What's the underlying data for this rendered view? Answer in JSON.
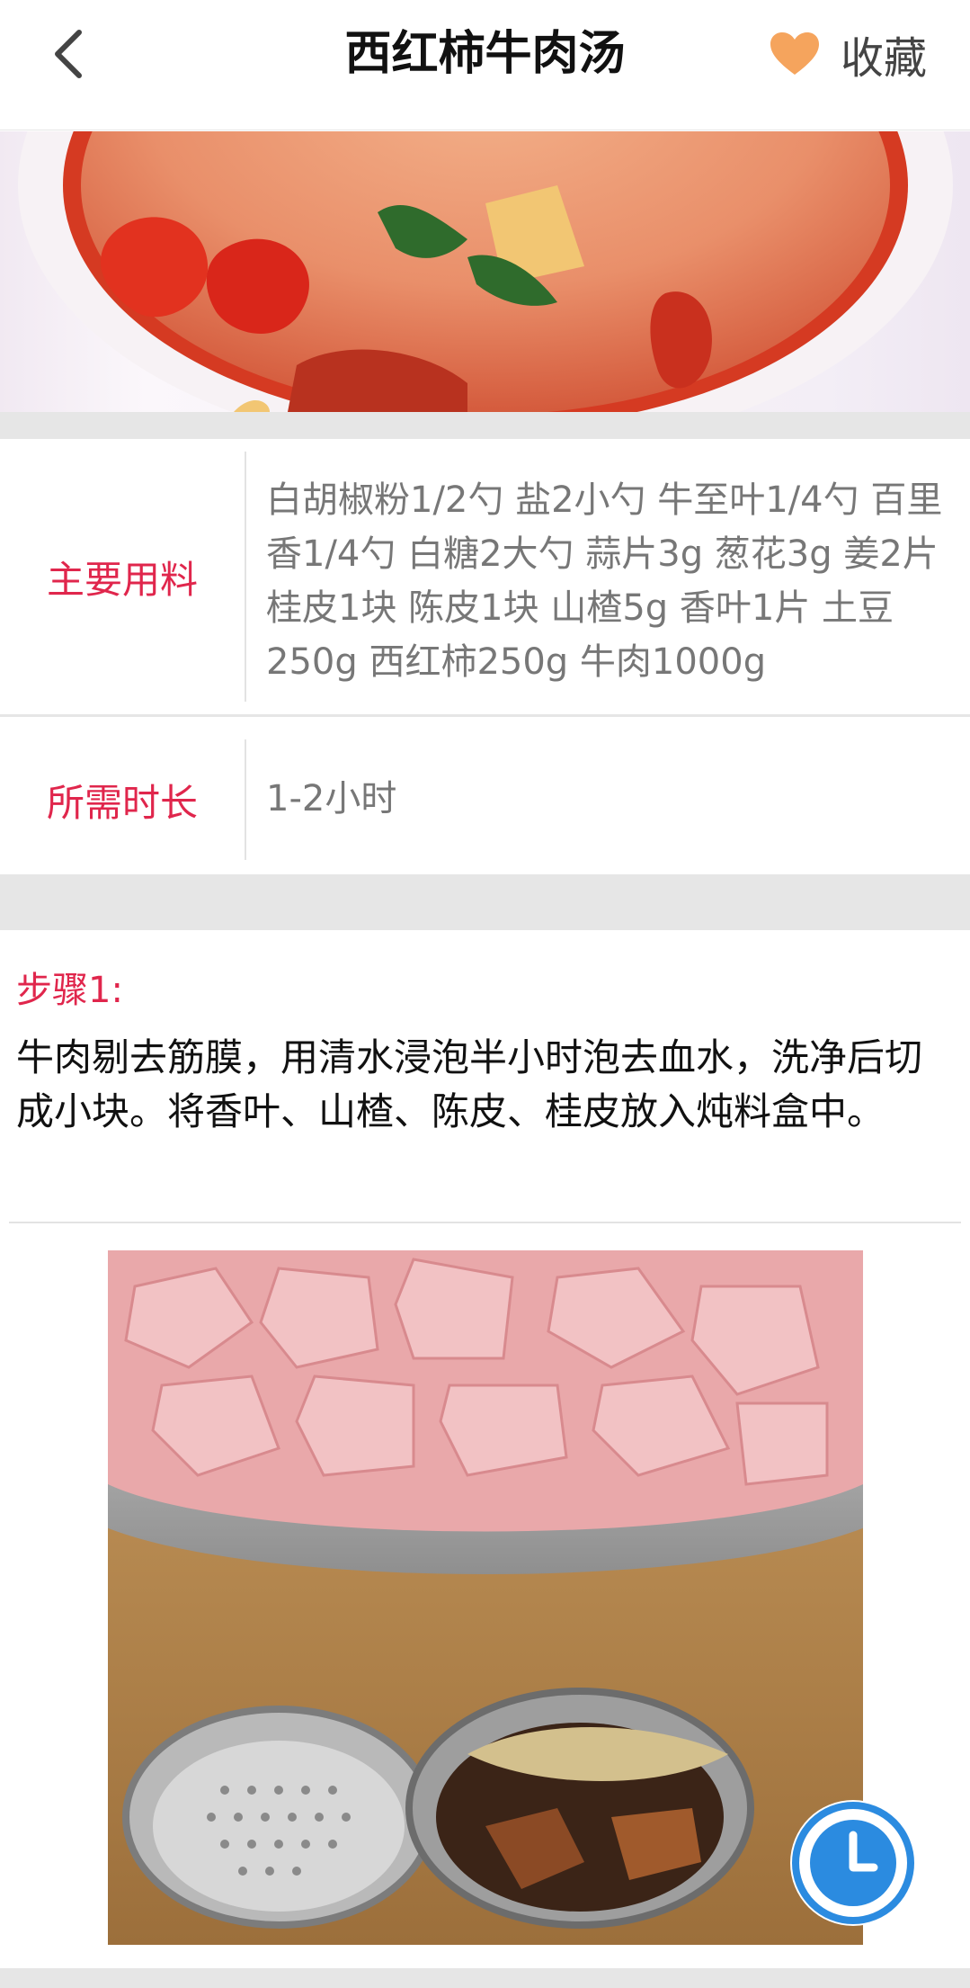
{
  "header": {
    "back_icon": "chevron-left-icon",
    "title": "西红柿牛肉汤",
    "favorite_icon": "heart-icon",
    "favorite_label": "收藏",
    "accent": "#f5a45d"
  },
  "info": {
    "ingredients_label": "主要用料",
    "ingredients_value": "白胡椒粉1/2勺 盐2小勺 牛至叶1/4勺 百里香1/4勺 白糖2大勺 蒜片3g 葱花3g 姜2片 桂皮1块 陈皮1块 山楂5g 香叶1片 土豆250g 西红柿250g 牛肉1000g",
    "duration_label": "所需时长",
    "duration_value": "1-2小时",
    "label_color": "#e0264c"
  },
  "steps": [
    {
      "title": "步骤1:",
      "text": "牛肉剔去筋膜，用清水浸泡半小时泡去血水，洗净后切成小块。将香叶、山楂、陈皮、桂皮放入炖料盒中。"
    }
  ],
  "timer": {
    "icon": "clock-icon",
    "color": "#2b8be0"
  }
}
